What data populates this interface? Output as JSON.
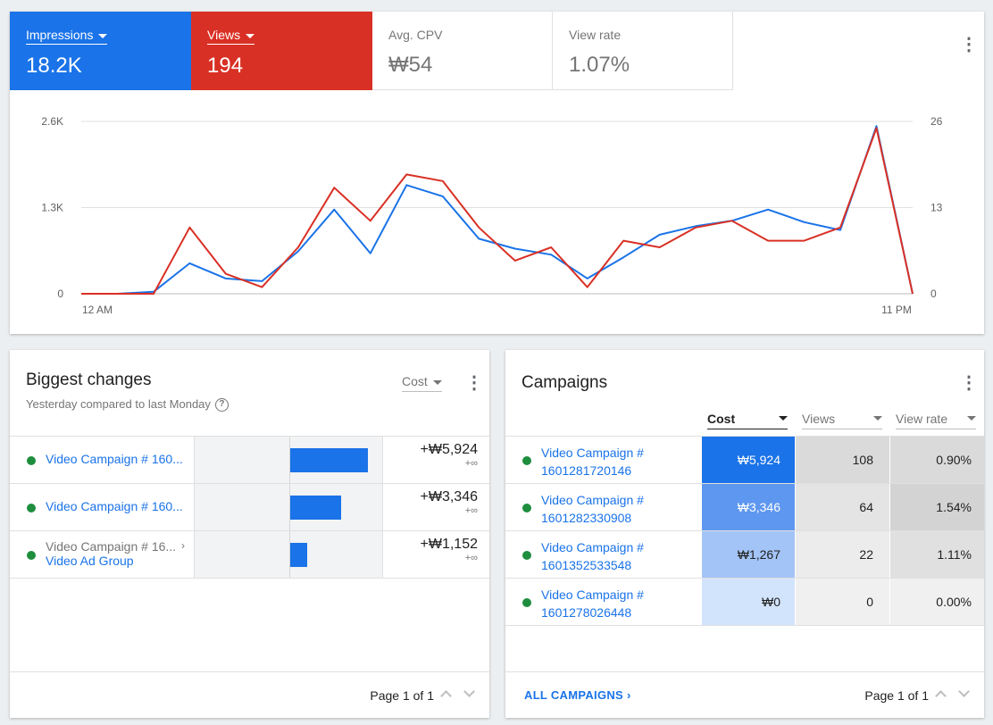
{
  "overview": {
    "metrics": [
      {
        "label": "Impressions",
        "value": "18.2K",
        "color": "#1a73e8",
        "selected": true
      },
      {
        "label": "Views",
        "value": "194",
        "color": "#d93025",
        "selected": true
      },
      {
        "label": "Avg. CPV",
        "value": "₩54",
        "selected": false
      },
      {
        "label": "View rate",
        "value": "1.07%",
        "selected": false
      }
    ],
    "menu_icon": "more-vert-icon"
  },
  "chart_data": {
    "type": "line",
    "x_tick_labels": [
      "12 AM",
      "11 PM"
    ],
    "left_axis": {
      "ticks": [
        "0",
        "1.3K",
        "2.6K"
      ],
      "ylim": [
        0,
        2600
      ]
    },
    "right_axis": {
      "ticks": [
        "0",
        "13",
        "26"
      ],
      "ylim": [
        0,
        26
      ]
    },
    "grid": true,
    "series": [
      {
        "name": "Impressions",
        "axis": "left",
        "color": "#1a73e8",
        "values": [
          0,
          0,
          30,
          460,
          230,
          190,
          640,
          1270,
          610,
          1640,
          1470,
          830,
          680,
          590,
          230,
          550,
          890,
          1020,
          1100,
          1270,
          1080,
          960,
          2530,
          0
        ]
      },
      {
        "name": "Views",
        "axis": "right",
        "color": "#d93025",
        "values": [
          0,
          0,
          0,
          10,
          3,
          1,
          7,
          16,
          11,
          18,
          17,
          10,
          5,
          7,
          1,
          8,
          7,
          10,
          11,
          8,
          8,
          10,
          25,
          0
        ]
      }
    ]
  },
  "changes": {
    "title": "Biggest changes",
    "subtitle": "Yesterday compared to last Monday",
    "sort_label": "Cost",
    "rows": [
      {
        "name": "Video Campaign # 160...",
        "sub": "",
        "value": "+₩5,924",
        "pct": "+∞",
        "bar": 1.0
      },
      {
        "name": "Video Campaign # 160...",
        "sub": "",
        "value": "+₩3,346",
        "pct": "+∞",
        "bar": 0.65
      },
      {
        "name": "Video Campaign # 16...",
        "sub": "Video Ad Group",
        "value": "+₩1,152",
        "pct": "+∞",
        "bar": 0.22
      }
    ],
    "pager": "Page 1 of 1"
  },
  "campaigns": {
    "title": "Campaigns",
    "columns": [
      "Cost",
      "Views",
      "View rate"
    ],
    "rows": [
      {
        "line1": "Video Campaign #",
        "line2": "1601281720146",
        "cost": "₩5,924",
        "views": "108",
        "rate": "0.90%",
        "cost_bg": "#1a73e8",
        "cost_fg": "#ffffff",
        "views_bg": "#dadada",
        "rate_bg": "#dadada"
      },
      {
        "line1": "Video Campaign #",
        "line2": "1601282330908",
        "cost": "₩3,346",
        "views": "64",
        "rate": "1.54%",
        "cost_bg": "#5e97ef",
        "cost_fg": "#ffffff",
        "views_bg": "#e4e4e4",
        "rate_bg": "#d3d3d3"
      },
      {
        "line1": "Video Campaign #",
        "line2": "1601352533548",
        "cost": "₩1,267",
        "views": "22",
        "rate": "1.11%",
        "cost_bg": "#a3c4f6",
        "cost_fg": "#212121",
        "views_bg": "#ececec",
        "rate_bg": "#e0e0e0"
      },
      {
        "line1": "Video Campaign #",
        "line2": "1601278026448",
        "cost": "₩0",
        "views": "0",
        "rate": "0.00%",
        "cost_bg": "#d2e3fc",
        "cost_fg": "#212121",
        "views_bg": "#f0f0f0",
        "rate_bg": "#f0f0f0"
      }
    ],
    "all_link": "ALL CAMPAIGNS",
    "pager": "Page 1 of 1"
  }
}
